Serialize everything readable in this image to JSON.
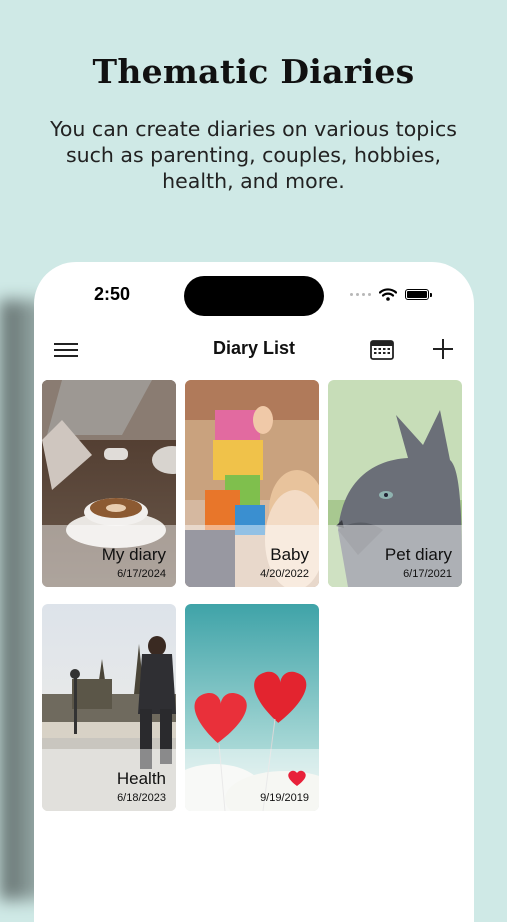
{
  "promo": {
    "title": "Thematic Diaries",
    "subtitle": "You can create diaries on various topics such as parenting, couples, hobbies, health, and more."
  },
  "status": {
    "time": "2:50"
  },
  "navbar": {
    "title": "Diary List",
    "menu_icon": "hamburger-menu-icon",
    "calendar_icon": "calendar-icon",
    "add_icon": "plus-icon"
  },
  "diaries": [
    {
      "label": "My diary",
      "date": "6/17/2024",
      "image": "coffee-laptop-photo"
    },
    {
      "label": "Baby",
      "date": "4/20/2022",
      "image": "child-blocks-photo"
    },
    {
      "label": "Pet diary",
      "date": "6/17/2021",
      "image": "gray-cat-photo"
    },
    {
      "label": "Health",
      "date": "6/18/2023",
      "image": "runner-photo"
    },
    {
      "label": "",
      "date": "9/19/2019",
      "image": "heart-balloons-photo",
      "badge_icon": "heart-icon"
    }
  ],
  "colors": {
    "background": "#cfe9e6",
    "heart": "#e8213a"
  }
}
